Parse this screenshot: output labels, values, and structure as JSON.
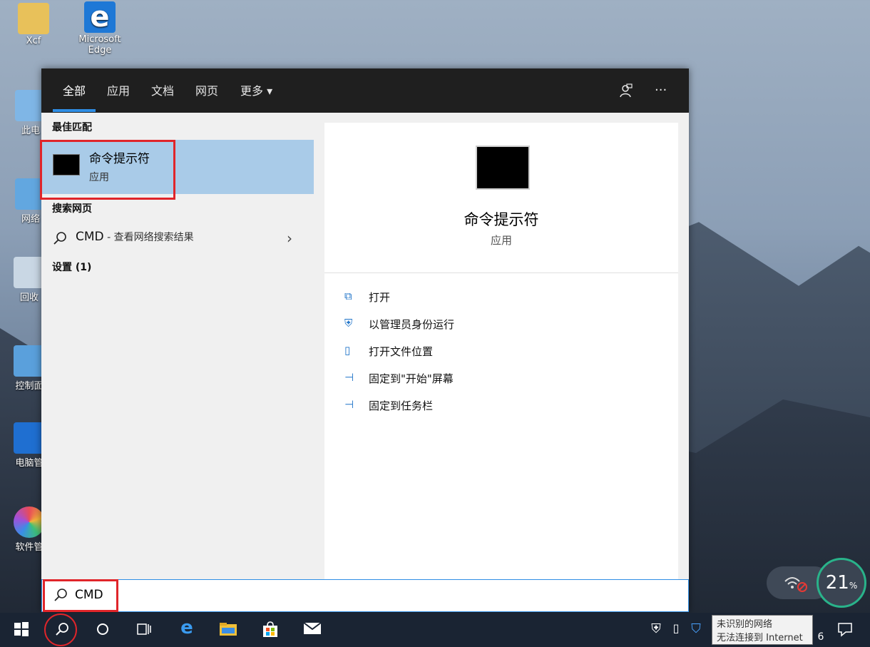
{
  "desktop": {
    "icons": [
      {
        "label": "Xcf"
      },
      {
        "label": "Microsoft Edge"
      },
      {
        "label": "此电"
      },
      {
        "label": "网络"
      },
      {
        "label": "回收"
      },
      {
        "label": "控制面"
      },
      {
        "label": "电脑管"
      },
      {
        "label": "软件管"
      }
    ]
  },
  "search_panel": {
    "tabs": [
      {
        "label": "全部",
        "active": true
      },
      {
        "label": "应用"
      },
      {
        "label": "文档"
      },
      {
        "label": "网页"
      },
      {
        "label": "更多 ▾"
      }
    ],
    "feedback_icon": "feedback-icon",
    "more_icon": "···",
    "best_match_header": "最佳匹配",
    "best_match": {
      "name": "命令提示符",
      "type": "应用"
    },
    "web_header": "搜索网页",
    "web_result": {
      "query": "CMD",
      "suffix": " - 查看网络搜索结果"
    },
    "settings_header": "设置 (1)",
    "detail": {
      "name": "命令提示符",
      "type": "应用",
      "actions": [
        {
          "icon": "open-icon",
          "glyph": "⧉",
          "label": "打开"
        },
        {
          "icon": "shield-run-icon",
          "glyph": "⛨",
          "label": "以管理员身份运行"
        },
        {
          "icon": "file-location-icon",
          "glyph": "▯",
          "label": "打开文件位置"
        },
        {
          "icon": "pin-icon",
          "glyph": "⊣",
          "label": "固定到\"开始\"屏幕"
        },
        {
          "icon": "pin-icon",
          "glyph": "⊣",
          "label": "固定到任务栏"
        }
      ]
    },
    "search_value": "CMD"
  },
  "taskbar": {
    "tooltip_line1": "未识别的网络",
    "tooltip_line2": "无法连接到 Internet",
    "clock_fragment": "6"
  },
  "widget": {
    "percent": "21",
    "unit": "%"
  },
  "colors": {
    "accent": "#2f8ee5",
    "highlight": "#a9cbe8",
    "annotation": "#e0252a"
  }
}
